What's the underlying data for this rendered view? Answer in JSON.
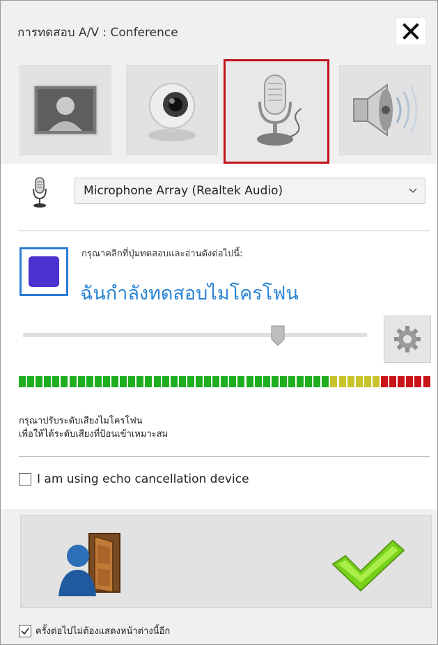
{
  "window": {
    "title": "การทดสอบ A/V : Conference",
    "close_icon": "close-icon"
  },
  "tabs": [
    {
      "name": "video-preview",
      "icon": "person-portrait-icon",
      "active": false
    },
    {
      "name": "webcam",
      "icon": "webcam-icon",
      "active": false
    },
    {
      "name": "microphone",
      "icon": "microphone-icon",
      "active": true
    },
    {
      "name": "speaker",
      "icon": "speaker-icon",
      "active": false
    }
  ],
  "device": {
    "icon": "microphone-icon",
    "selected": "Microphone Array (Realtek Audio)"
  },
  "test": {
    "instruction": "กรุณาคลิกที่ปุ่มทดสอบและอ่านดังต่อไปนี้:",
    "phrase": "ฉันกำลังทดสอบไมโครโฟน",
    "button_icon": "stop-icon"
  },
  "volume": {
    "level": 0.74,
    "settings_icon": "gear-icon"
  },
  "meter": {
    "segments_total": 49,
    "green": 37,
    "yellow": 6,
    "red": 6,
    "colors": {
      "green": "#1fae1f",
      "yellow": "#c9c32a",
      "red": "#c9141a"
    }
  },
  "hint": {
    "line1": "กรุณาปรับระดับเสียงไมโครโฟน",
    "line2": "เพื่อให้ได้ระดับเสียงที่ป้อนเข้าเหมาะสม"
  },
  "echo": {
    "label": "I am using echo cancellation device",
    "checked": false
  },
  "actions": {
    "exit_icon": "exit-door-icon",
    "ok_icon": "checkmark-icon"
  },
  "footer": {
    "label": "ครั้งต่อไปไม่ต้องแสดงหน้าต่างนี้อีก",
    "checked": true
  },
  "accent_color": "#2b84d4",
  "active_border_color": "#c0141a"
}
